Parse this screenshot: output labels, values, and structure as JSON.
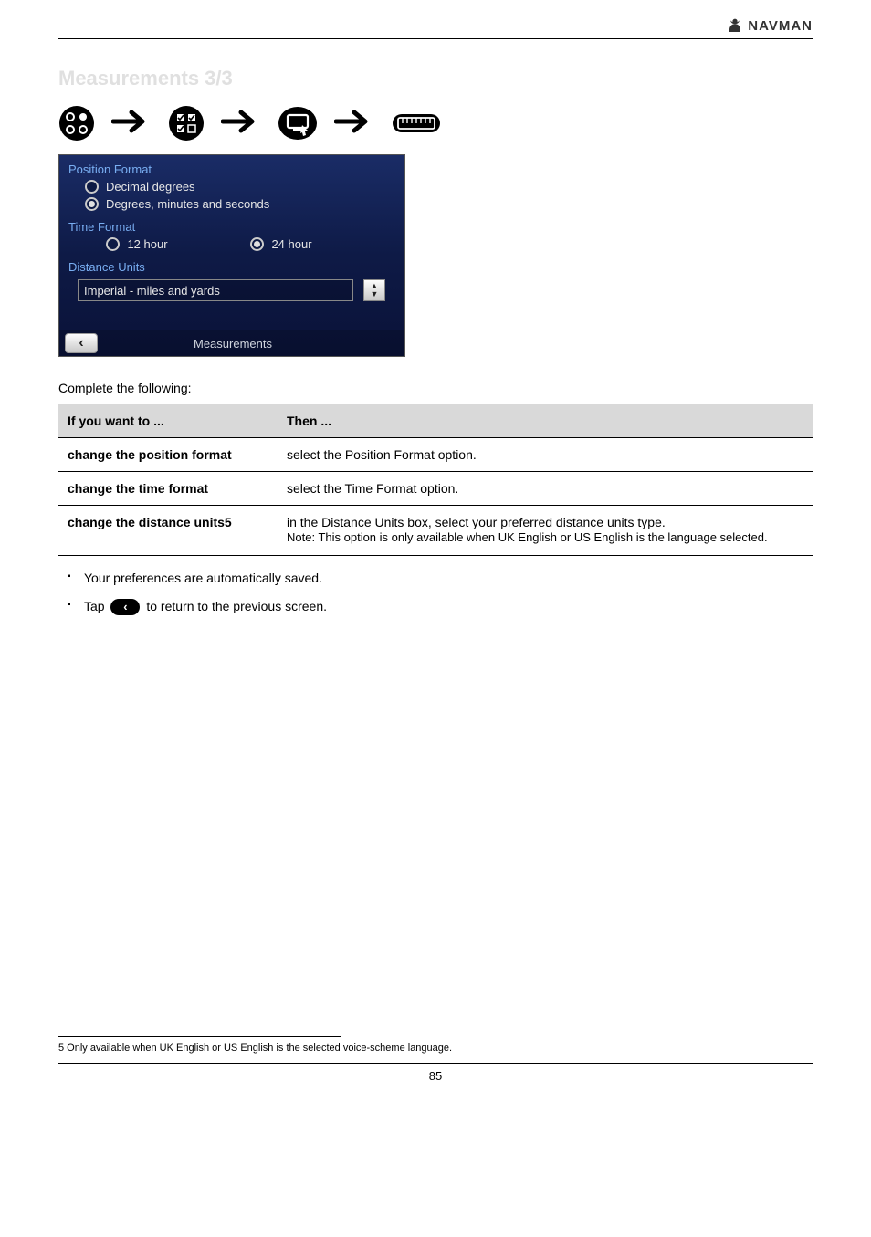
{
  "header": {
    "brand": "NAVMAN"
  },
  "title": "Measurements 3/3",
  "screenshot": {
    "sections": {
      "position_format": {
        "label": "Position Format",
        "opt1": "Decimal degrees",
        "opt2": "Degrees, minutes and seconds"
      },
      "time_format": {
        "label": "Time Format",
        "opt1": "12 hour",
        "opt2": "24 hour"
      },
      "distance_units": {
        "label": "Distance Units",
        "value": "Imperial - miles and yards"
      }
    },
    "screen_title": "Measurements"
  },
  "intro": "Complete the following:",
  "table": {
    "h1": "If you want to ...",
    "h2": "Then ...",
    "rows": [
      {
        "c1": "change the position format",
        "c2": "select the Position Format option."
      },
      {
        "c1": "change the time format",
        "c2": "select the Time Format option."
      },
      {
        "c1": "change the distance units5",
        "c2": "in the Distance Units box, select your preferred distance units type.",
        "note": "Note: This option is only available when UK English or US English is the language selected."
      }
    ]
  },
  "bullets": {
    "b1": "Your preferences are automatically saved.",
    "b2_pre": "Tap ",
    "b2_post": " to return to the previous screen."
  },
  "footnote": "5 Only available when UK English or US English is the selected voice-scheme language.",
  "page": "85"
}
